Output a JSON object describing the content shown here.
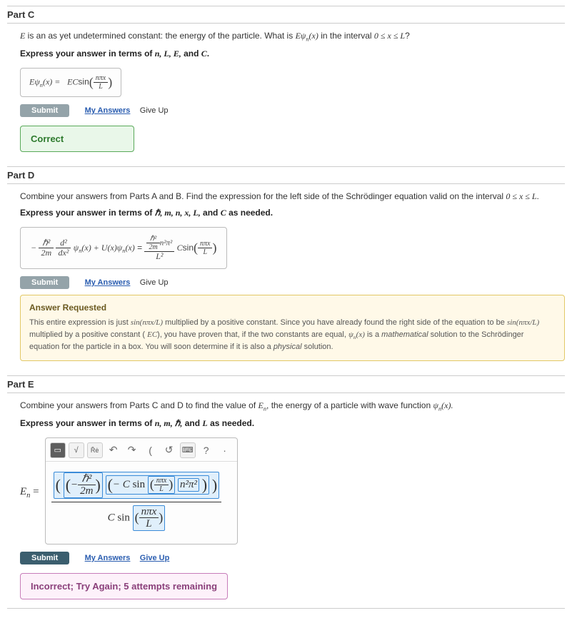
{
  "common": {
    "submit": "Submit",
    "my_answers": "My Answers",
    "give_up": "Give Up"
  },
  "partC": {
    "title": "Part C",
    "prompt_a": "E",
    "prompt_b": " is an as yet undetermined constant: the energy of the particle. What is ",
    "prompt_c": "Eψ",
    "prompt_sub": "n",
    "prompt_d": "(x)",
    "prompt_e": " in the interval ",
    "prompt_f": "0 ≤ x ≤ L",
    "prompt_g": "?",
    "hint_a": "Express your answer in terms of ",
    "hint_b": "n, L, E,",
    "hint_c": " and ",
    "hint_d": "C",
    "hint_e": ".",
    "ans_lhs_a": "Eψ",
    "ans_lhs_b": "n",
    "ans_lhs_c": "(x) = ",
    "ans_rhs_a": "EC",
    "ans_rhs_b": "sin",
    "ans_frac_num": "nπx",
    "ans_frac_den": "L",
    "feedback": "Correct"
  },
  "partD": {
    "title": "Part D",
    "prompt_a": "Combine your answers from Parts A and B. Find the expression for the left side of the Schrödinger equation valid on the interval ",
    "prompt_b": "0 ≤ x ≤ L",
    "prompt_c": ".",
    "hint_a": "Express your answer in terms of ",
    "hint_b": "ℏ, m, n, x, L,",
    "hint_c": " and ",
    "hint_d": "C",
    "hint_e": " as needed.",
    "lhs": {
      "minus": "−",
      "f1num": "ℏ²",
      "f1den": "2m",
      "f2num": "d²",
      "f2den": "dx²",
      "psi_a": " ψ",
      "psi_n": "n",
      "psi_b": "(x) + U(x)ψ",
      "psi_c": "(x)",
      "eq": " = "
    },
    "rhs": {
      "topnum_a": "ℏ²",
      "topnum_b": "n²π²",
      "topden": "2m",
      "over": "L²",
      "c": " C",
      "sin": "sin",
      "fnum": "nπx",
      "fden": "L"
    },
    "ar_title": "Answer Requested",
    "ar_body_a": "This entire expression is just ",
    "ar_body_b": "sin(nπx/L)",
    "ar_body_c": " multiplied by a positive constant. Since you have already found the right side of the equation to be ",
    "ar_body_d": "sin(nπx/L)",
    "ar_body_e": " multiplied by a positive constant ( ",
    "ar_body_f": "EC",
    "ar_body_g": "), you have proven that, if the two constants are equal, ",
    "ar_body_h": "ψ",
    "ar_body_hn": "n",
    "ar_body_i": "(x)",
    "ar_body_j": " is a ",
    "ar_body_k": "mathematical",
    "ar_body_l": " solution to the Schrödinger equation for the particle in a box. You will soon determine if it is also a ",
    "ar_body_m": "physical",
    "ar_body_n": " solution."
  },
  "partE": {
    "title": "Part E",
    "prompt_a": "Combine your answers from Parts C and D to find the value of ",
    "prompt_b": "E",
    "prompt_bn": "n",
    "prompt_c": ", the energy of a particle with wave function ",
    "prompt_d": "ψ",
    "prompt_dn": "n",
    "prompt_e": "(x).",
    "hint_a": "Express your answer in terms of ",
    "hint_b": "n, m, ℏ,",
    "hint_c": " and ",
    "hint_d": "L",
    "hint_e": " as needed.",
    "lhs_a": "E",
    "lhs_n": "n",
    "lhs_eq": " = ",
    "tool_help": "?",
    "tool_keyb": "⌨",
    "tool_undo": "↶",
    "tool_redo": "↷",
    "tool_reset": "↺",
    "tool_paren": "(",
    "expr": {
      "minus1": "−",
      "h2": "ℏ²",
      "twom": "2m",
      "minus2": "− ",
      "C": "C ",
      "sin": "sin",
      "npix": "nπx",
      "L": "L",
      "n2pi2": "n²π²",
      "C2": "C ",
      "sin2": "sin"
    },
    "feedback": "Incorrect; Try Again; 5 attempts remaining"
  }
}
